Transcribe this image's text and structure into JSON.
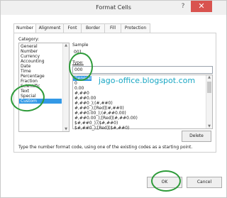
{
  "window": {
    "title": "Format Cells",
    "help_glyph": "?",
    "close_glyph": "✕"
  },
  "tabs": [
    {
      "label": "Number",
      "active": true
    },
    {
      "label": "Alignment",
      "active": false
    },
    {
      "label": "Font",
      "active": false
    },
    {
      "label": "Border",
      "active": false
    },
    {
      "label": "Fill",
      "active": false
    },
    {
      "label": "Protection",
      "active": false
    }
  ],
  "category": {
    "label": "Category:",
    "items": [
      "General",
      "Number",
      "Currency",
      "Accounting",
      "Date",
      "Time",
      "Percentage",
      "Fraction",
      "Scientific",
      "Text",
      "Special",
      "Custom"
    ],
    "selected": "Custom"
  },
  "sample": {
    "label": "Sample",
    "value": "001"
  },
  "type": {
    "label": "Type:",
    "value": "000",
    "items": [
      "General",
      "0",
      "0.00",
      "#,##0",
      "#,##0.00",
      "#,##0_);(#,##0)",
      "#,##0_);[Red](#,##0)",
      "#,##0.00_);(#,##0.00)",
      "#,##0.00_);[Red](#,##0.00)",
      "$#,##0_);($#,##0)",
      "$#,##0_);[Red]($#,##0)"
    ],
    "highlighted_index": 0
  },
  "watermark": "jago-office.blogspot.com",
  "buttons": {
    "delete": "Delete",
    "ok": "OK",
    "cancel": "Cancel"
  },
  "description": "Type the number format code, using one of the existing codes as a starting point.",
  "colors": {
    "annotation_green": "#2e9b3a",
    "selection_blue": "#3399e6",
    "close_red": "#d9534f"
  }
}
